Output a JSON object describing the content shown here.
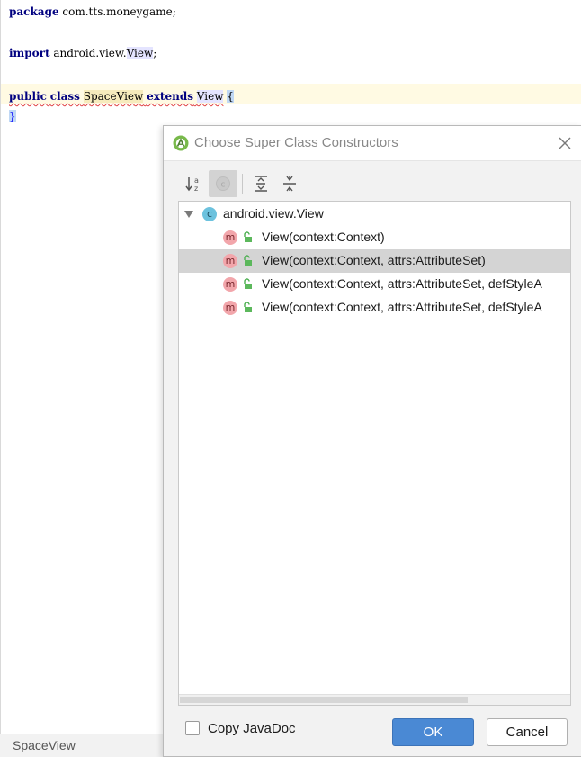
{
  "editor": {
    "line1": {
      "keyword": "package",
      "rest": " com.tts.moneygame;"
    },
    "line2": {
      "keyword": "import",
      "pre": " android.view.",
      "highlight": "View",
      "post": ";"
    },
    "line3": {
      "kw1": "public",
      "kw2": "class",
      "classname": "SpaceView",
      "kw3": "extends",
      "superclass": "View",
      "brace_open": "{"
    },
    "line4": {
      "brace_close": "}"
    }
  },
  "status_bar": {
    "text": "SpaceView"
  },
  "dialog": {
    "title": "Choose Super Class Constructors",
    "icon": "android-studio-icon",
    "toolbar": {
      "buttons": [
        "sort-alphabetically-icon",
        "show-classes-icon",
        "expand-all-icon",
        "collapse-all-icon"
      ],
      "active": "show-classes-icon"
    },
    "tree": {
      "root": {
        "label": "android.view.View",
        "icon_letter": "c"
      },
      "items": [
        {
          "label": "View(context:Context)",
          "icon_letter": "m"
        },
        {
          "label": "View(context:Context, attrs:AttributeSet)",
          "icon_letter": "m",
          "selected": true
        },
        {
          "label": "View(context:Context, attrs:AttributeSet, defStyleA",
          "icon_letter": "m"
        },
        {
          "label": "View(context:Context, attrs:AttributeSet, defStyleA",
          "icon_letter": "m"
        }
      ]
    },
    "copy_javadoc": {
      "pre": "Copy ",
      "mnemonic": "J",
      "post": "avaDoc",
      "checked": false
    },
    "ok_label": "OK",
    "cancel_label": "Cancel"
  },
  "colors": {
    "keyword": "#000080",
    "ok_button": "#4a89d4",
    "selection": "#d4d4d4",
    "class_icon": "#6cc2de",
    "method_icon": "#f2a6ab",
    "lock_icon": "#5cb85c"
  }
}
